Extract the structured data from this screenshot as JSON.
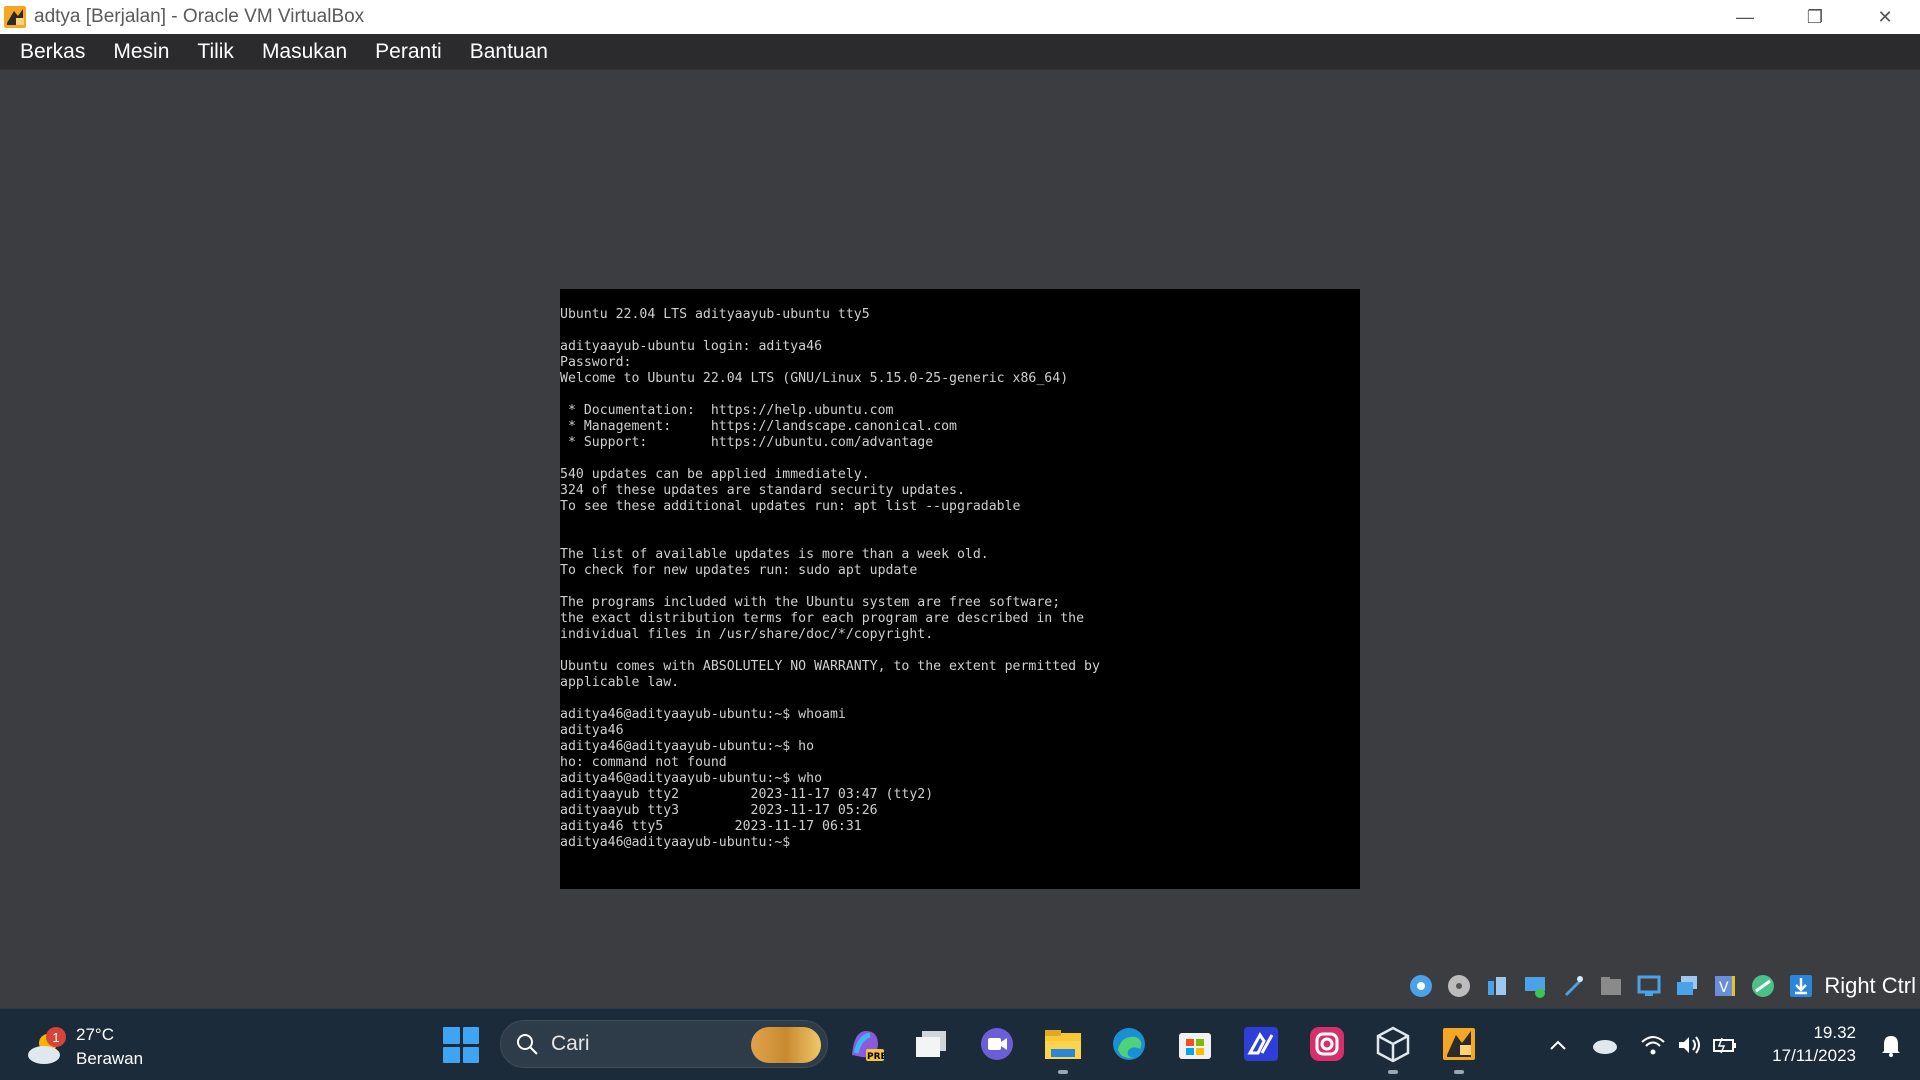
{
  "window": {
    "title": "adtya [Berjalan] - Oracle VM VirtualBox",
    "controls": {
      "minimize": "—",
      "restore": "❐",
      "close": "✕"
    }
  },
  "menu": [
    "Berkas",
    "Mesin",
    "Tilik",
    "Masukan",
    "Peranti",
    "Bantuan"
  ],
  "terminal": {
    "lines": [
      "Ubuntu 22.04 LTS adityaayub-ubuntu tty5",
      "",
      "adityaayub-ubuntu login: aditya46",
      "Password:",
      "Welcome to Ubuntu 22.04 LTS (GNU/Linux 5.15.0-25-generic x86_64)",
      "",
      " * Documentation:  https://help.ubuntu.com",
      " * Management:     https://landscape.canonical.com",
      " * Support:        https://ubuntu.com/advantage",
      "",
      "540 updates can be applied immediately.",
      "324 of these updates are standard security updates.",
      "To see these additional updates run: apt list --upgradable",
      "",
      "",
      "The list of available updates is more than a week old.",
      "To check for new updates run: sudo apt update",
      "",
      "The programs included with the Ubuntu system are free software;",
      "the exact distribution terms for each program are described in the",
      "individual files in /usr/share/doc/*/copyright.",
      "",
      "Ubuntu comes with ABSOLUTELY NO WARRANTY, to the extent permitted by",
      "applicable law.",
      "",
      "aditya46@adityaayub-ubuntu:~$ whoami",
      "aditya46",
      "aditya46@adityaayub-ubuntu:~$ ho",
      "ho: command not found",
      "aditya46@adityaayub-ubuntu:~$ who",
      "adityaayub tty2         2023-11-17 03:47 (tty2)",
      "adityaayub tty3         2023-11-17 05:26",
      "aditya46 tty5         2023-11-17 06:31",
      "aditya46@adityaayub-ubuntu:~$"
    ]
  },
  "statusbar": {
    "icons": [
      "hard-disk-icon",
      "optical-drive-icon",
      "audio-icon",
      "network-icon",
      "usb-icon",
      "shared-folder-icon",
      "display-icon",
      "video-capture-icon",
      "recording-icon",
      "guest-additions-icon",
      "mouse-integration-icon",
      "download-icon"
    ],
    "host_key": "Right Ctrl"
  },
  "taskbar": {
    "weather_temp": "27°C",
    "weather_desc": "Berawan",
    "weather_badge": "1",
    "search_placeholder": "Cari",
    "apps": [
      "copilot-icon",
      "task-view-icon",
      "teams-icon",
      "file-explorer-icon",
      "edge-icon",
      "store-icon",
      "app-icon",
      "instagram-icon",
      "virtualbox-icon",
      "virtualbox-vm-icon"
    ],
    "copilot_badge": "PRE",
    "clock_time": "19.32",
    "clock_date": "17/11/2023",
    "colors": {
      "accent": "#3fa5f2",
      "taskbar": "#1c2b3a"
    }
  }
}
